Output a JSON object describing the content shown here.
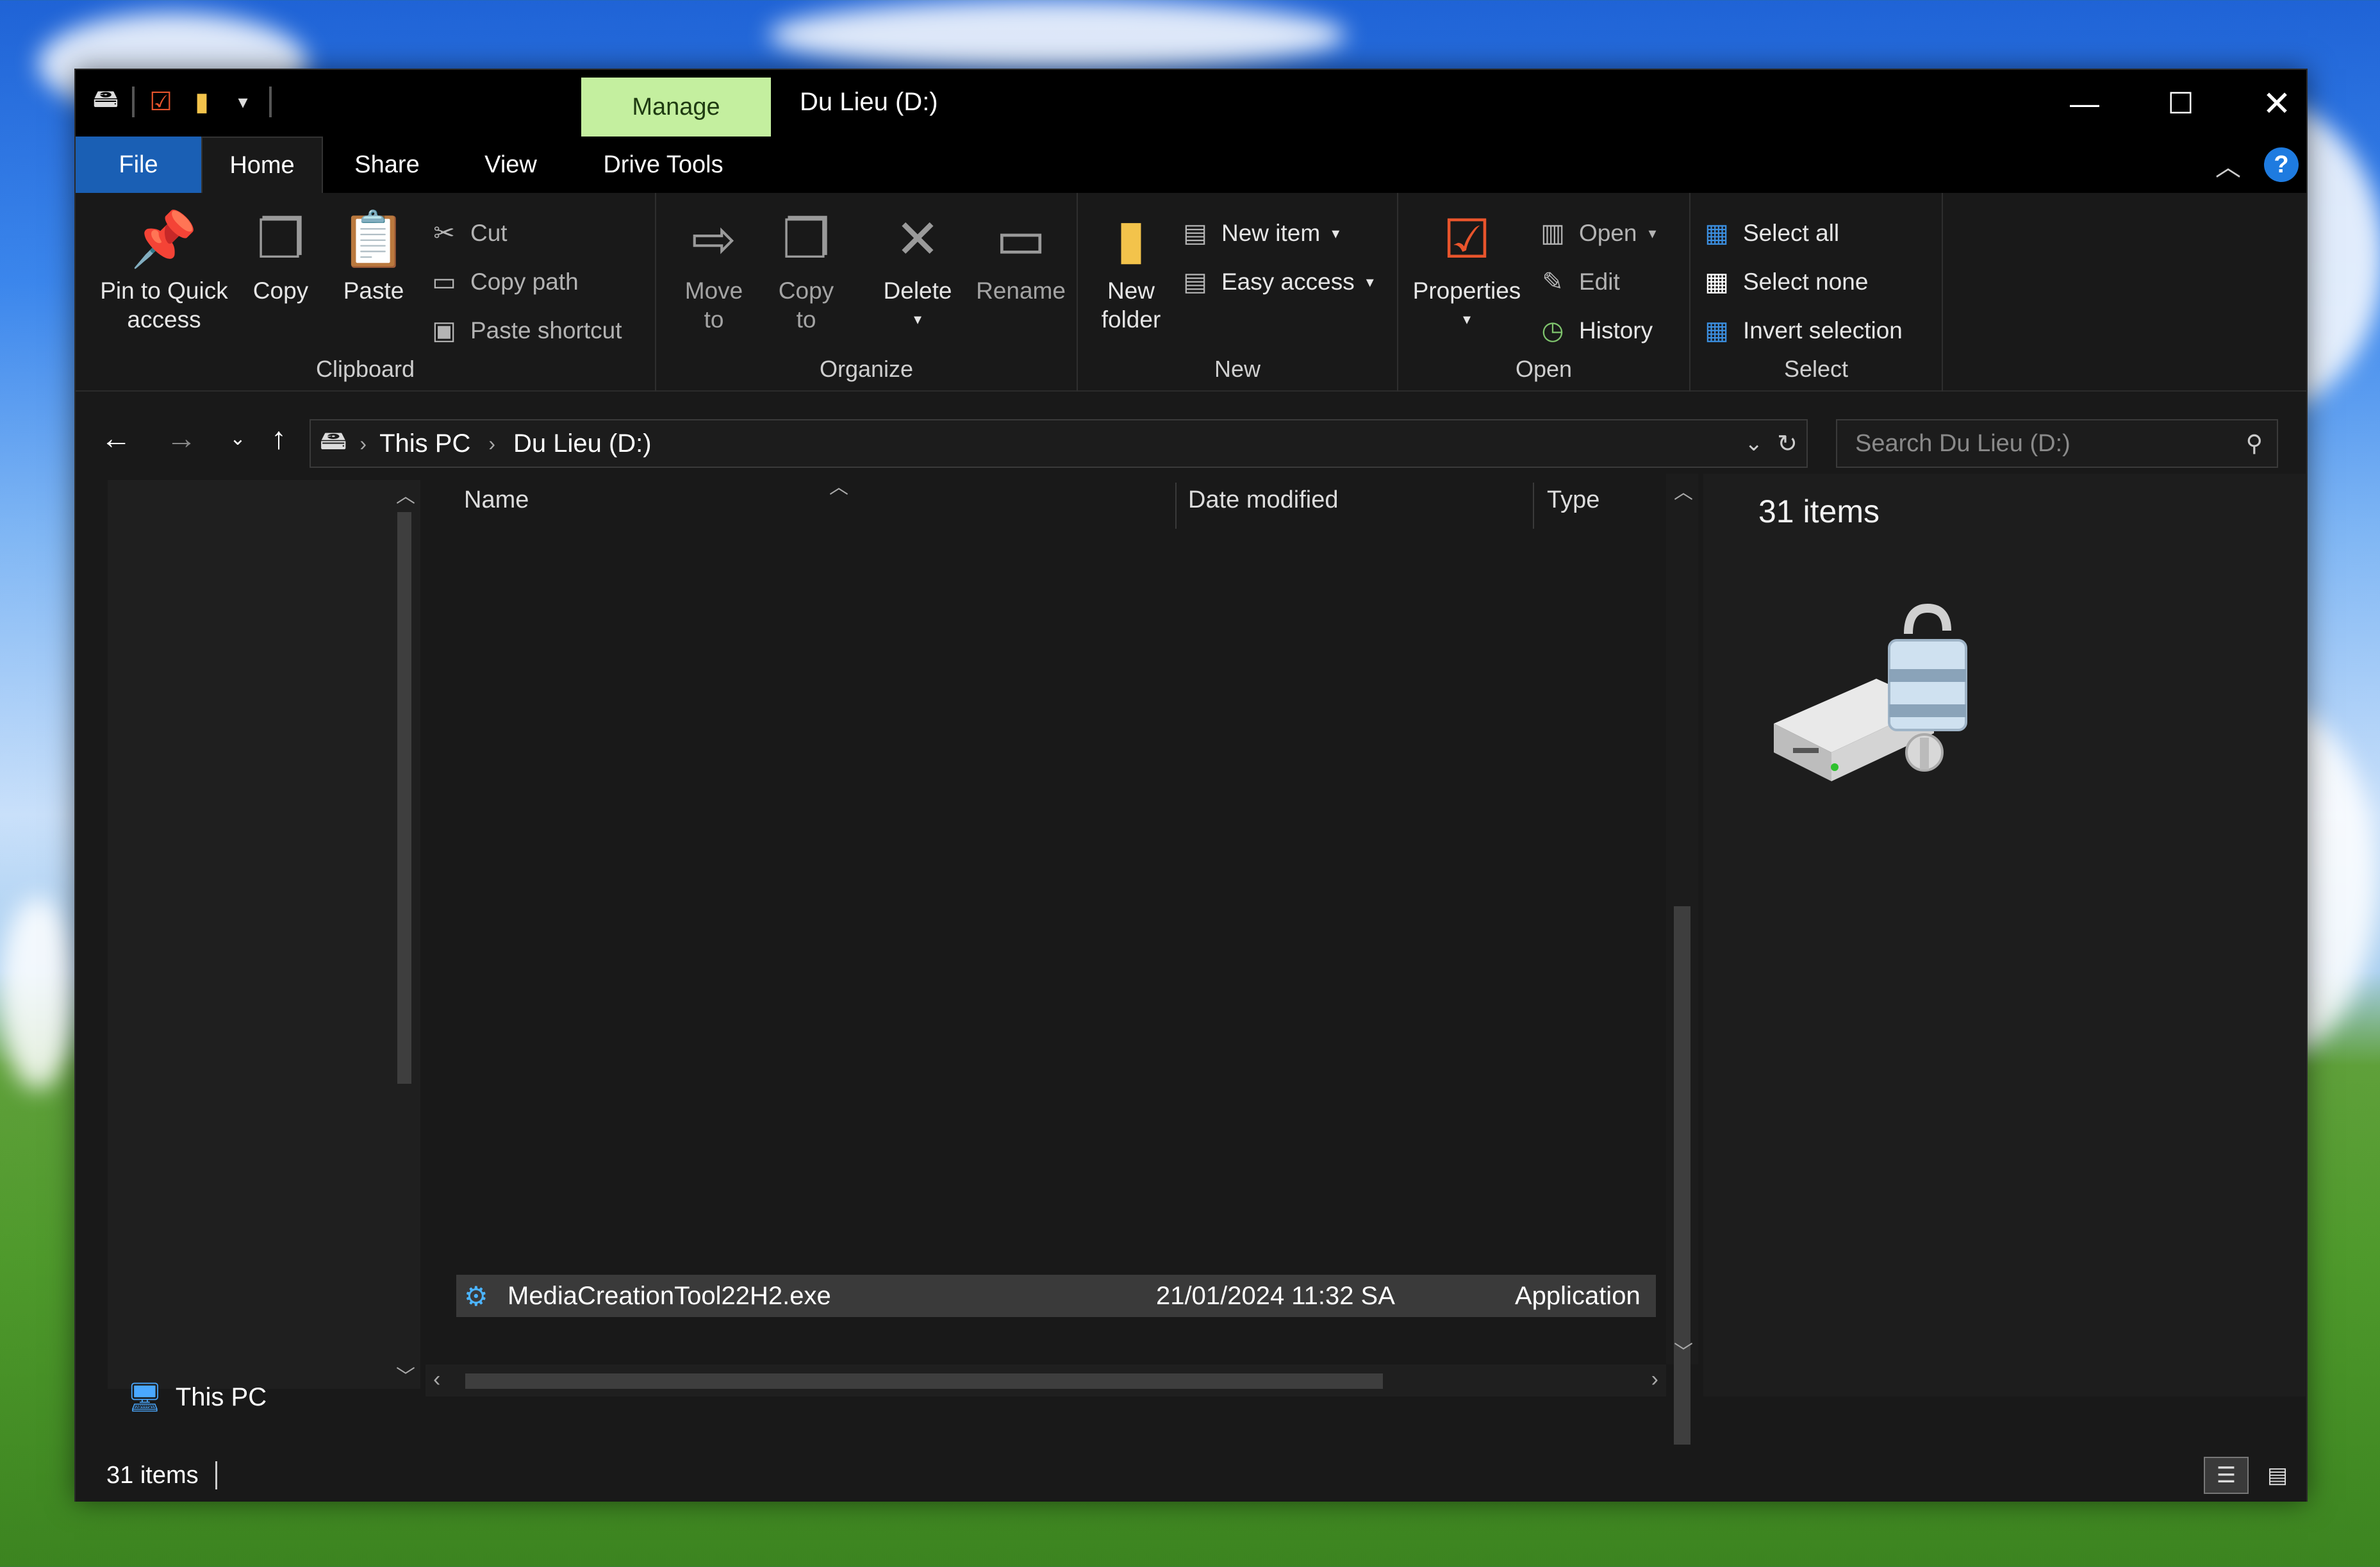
{
  "window": {
    "title": "Du Lieu (D:)",
    "context_tab": "Manage",
    "controls": {
      "minimize_icon": "minimize-icon",
      "maximize_icon": "maximize-icon",
      "close_icon": "close-icon"
    }
  },
  "tabs": {
    "file": "File",
    "home": "Home",
    "share": "Share",
    "view": "View",
    "drive_tools": "Drive Tools",
    "active": "Home"
  },
  "ribbon": {
    "clipboard": {
      "label": "Clipboard",
      "pin": "Pin to Quick access",
      "pin_line1": "Pin to Quick",
      "pin_line2": "access",
      "copy": "Copy",
      "paste": "Paste",
      "cut": "Cut",
      "copy_path": "Copy path",
      "paste_shortcut": "Paste shortcut"
    },
    "organize": {
      "label": "Organize",
      "move_to_1": "Move",
      "move_to_2": "to",
      "copy_to_1": "Copy",
      "copy_to_2": "to",
      "delete": "Delete",
      "rename": "Rename"
    },
    "new": {
      "label": "New",
      "new_folder_1": "New",
      "new_folder_2": "folder",
      "new_item": "New item",
      "easy_access": "Easy access"
    },
    "open": {
      "label": "Open",
      "properties": "Properties",
      "open": "Open",
      "edit": "Edit",
      "history": "History"
    },
    "select": {
      "label": "Select",
      "select_all": "Select all",
      "select_none": "Select none",
      "invert": "Invert selection"
    }
  },
  "address": {
    "breadcrumb": [
      "This PC",
      "Du Lieu (D:)"
    ],
    "search_placeholder": "Search Du Lieu (D:)"
  },
  "navpane": {
    "this_pc": "This PC"
  },
  "file_list": {
    "columns": [
      "Name",
      "Date modified",
      "Type"
    ],
    "rows": [
      {
        "name": "MediaCreationTool22H2.exe",
        "date": "21/01/2024 11:32 SA",
        "type": "Application"
      }
    ]
  },
  "details_pane": {
    "count": "31 items"
  },
  "status_bar": {
    "count": "31 items"
  },
  "colors": {
    "accent": "#1a5fb4",
    "manage_tab": "#c4ef9f",
    "background": "#191919"
  }
}
